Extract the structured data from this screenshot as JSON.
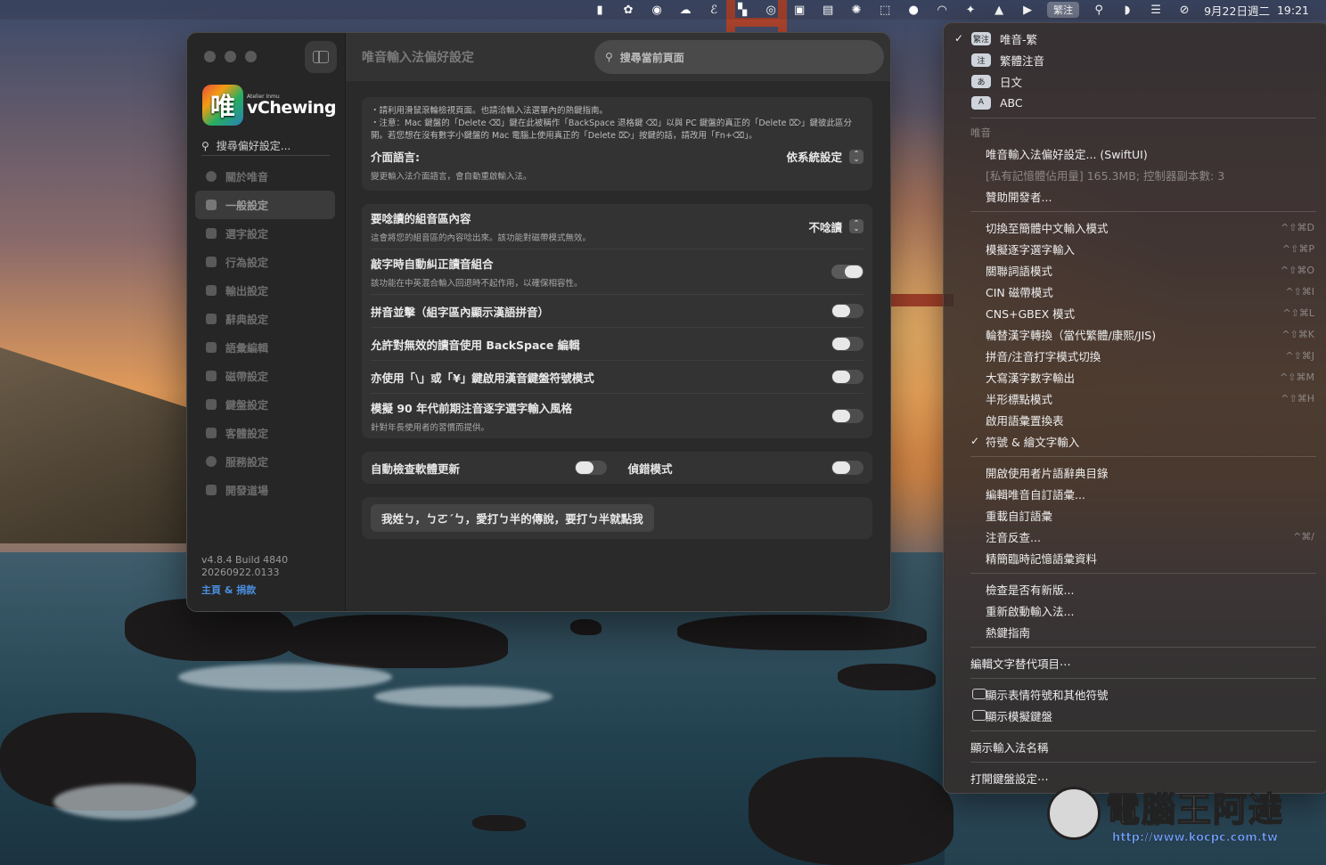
{
  "menubar": {
    "ime_icon": "繁注",
    "date": "9月22日週二",
    "time": "19:21",
    "icons": [
      "battery-icon",
      "openai-icon",
      "finder-icon",
      "cloud-icon",
      "e-app-icon",
      "layout-icon",
      "airdrop-icon",
      "c-app-icon",
      "notion-icon",
      "burst-icon",
      "screenshot-icon",
      "line-app-icon",
      "rss-icon",
      "sparkle-icon",
      "upload-icon",
      "play-icon",
      "search-icon",
      "wifi-icon",
      "control-center-icon",
      "vpn-icon"
    ]
  },
  "window": {
    "title": "唯音輸入法偏好設定",
    "search_placeholder": "搜尋當前頁面",
    "logo_sub": "Atelier Inmu",
    "logo_name": "vChewing",
    "logo_glyph": "唯",
    "side_search_placeholder": "搜尋偏好設定...",
    "nav": [
      {
        "label": "關於唯音",
        "icon": "info-icon"
      },
      {
        "label": "一般設定",
        "icon": "tools-icon"
      },
      {
        "label": "選字設定",
        "icon": "candidate-icon"
      },
      {
        "label": "行為設定",
        "icon": "behavior-icon"
      },
      {
        "label": "輸出設定",
        "icon": "output-icon"
      },
      {
        "label": "辭典設定",
        "icon": "dictionary-icon"
      },
      {
        "label": "語彙編輯",
        "icon": "phrase-edit-icon"
      },
      {
        "label": "磁帶設定",
        "icon": "cassette-icon"
      },
      {
        "label": "鍵盤設定",
        "icon": "keyboard-icon"
      },
      {
        "label": "客體設定",
        "icon": "client-icon"
      },
      {
        "label": "服務設定",
        "icon": "service-icon"
      },
      {
        "label": "開發道場",
        "icon": "dev-icon"
      }
    ],
    "active_nav": 1,
    "version": "v4.8.4 Build 4840",
    "build_date": "20260922.0133",
    "homepage_link": "主頁 & 捐款"
  },
  "general": {
    "notes": [
      "・請利用滑鼠滾輪檢視頁面。也請洽輸入法選單內的熱鍵指南。",
      "・注意：Mac 鍵盤的「Delete ⌫」鍵在此被稱作「BackSpace 退格鍵 ⌫」以與 PC 鍵盤的真正的「Delete ⌦」鍵彼此區分開。若您想在沒有數字小鍵盤的 Mac 電腦上使用真正的「Delete ⌦」按鍵的話，請改用「Fn+⌫」。"
    ],
    "ui_lang_label": "介面語言:",
    "ui_lang_value": "依系統設定",
    "ui_lang_desc": "變更輸入法介面語言，會自動重啟輸入法。",
    "read_label": "要唸讀的組音區內容",
    "read_value": "不唸讀",
    "read_desc": "這會將您的組音區的內容唸出來。該功能對磁帶模式無效。",
    "settings": [
      {
        "label": "敲字時自動糾正讀音組合",
        "desc": "該功能在中英混合輸入回退時不起作用，以確保相容性。",
        "on": true
      },
      {
        "label": "拼音並擊（組字區內顯示漢語拼音）",
        "desc": "",
        "on": false
      },
      {
        "label": "允許對無效的讀音使用 BackSpace 編輯",
        "desc": "",
        "on": false
      },
      {
        "label": "亦使用「\\」或「¥」鍵啟用漢音鍵盤符號模式",
        "desc": "",
        "on": false
      },
      {
        "label": "模擬 90 年代前期注音逐字選字輸入風格",
        "desc": "針對年長使用者的習慣而提供。",
        "on": false
      }
    ],
    "auto_update_label": "自動檢查軟體更新",
    "auto_update_on": false,
    "debug_label": "偵錯模式",
    "debug_on": false,
    "motto_button": "我姓ㄅ，ㄅㄛˊㄅ，愛打ㄅ半的傳說，要打ㄅ半就點我"
  },
  "menu": {
    "input_sources": [
      {
        "badge": "繁注",
        "label": "唯音-繁",
        "checked": true
      },
      {
        "badge": "注",
        "label": "繁體注音",
        "checked": false
      },
      {
        "badge": "あ",
        "label": "日文",
        "checked": false
      },
      {
        "badge": "A",
        "label": "ABC",
        "checked": false
      }
    ],
    "section_header": "唯音",
    "app_items": [
      {
        "label": "唯音輸入法偏好設定... (SwiftUI)",
        "dim": false
      },
      {
        "label": "[私有記憶體佔用量] 165.3MB; 控制器副本數: 3",
        "dim": true
      },
      {
        "label": "贊助開發者...",
        "dim": false
      }
    ],
    "modes": [
      {
        "label": "切換至簡體中文輸入模式",
        "shortcut": "^⇧⌘D",
        "checked": false
      },
      {
        "label": "模擬逐字選字輸入",
        "shortcut": "^⇧⌘P",
        "checked": false
      },
      {
        "label": "關聯詞語模式",
        "shortcut": "^⇧⌘O",
        "checked": false
      },
      {
        "label": "CIN 磁帶模式",
        "shortcut": "^⇧⌘I",
        "checked": false
      },
      {
        "label": "CNS+GBEX 模式",
        "shortcut": "^⇧⌘L",
        "checked": false
      },
      {
        "label": "輪替漢字轉換（當代繁體/康熙/JIS)",
        "shortcut": "^⇧⌘K",
        "checked": false
      },
      {
        "label": "拼音/注音打字模式切換",
        "shortcut": "^⇧⌘J",
        "checked": false
      },
      {
        "label": "大寫漢字數字輸出",
        "shortcut": "^⇧⌘M",
        "checked": false
      },
      {
        "label": "半形標點模式",
        "shortcut": "^⇧⌘H",
        "checked": false
      },
      {
        "label": "啟用語彙置換表",
        "shortcut": "",
        "checked": false
      },
      {
        "label": "符號 & 繪文字輸入",
        "shortcut": "",
        "checked": true
      }
    ],
    "dict_items": [
      {
        "label": "開啟使用者片語辭典目錄",
        "shortcut": ""
      },
      {
        "label": "編輯唯音自訂語彙...",
        "shortcut": ""
      },
      {
        "label": "重載自訂語彙",
        "shortcut": ""
      },
      {
        "label": "注音反查...",
        "shortcut": "^⌘/"
      },
      {
        "label": "精簡臨時記憶語彙資料",
        "shortcut": ""
      }
    ],
    "maint_items": [
      "檢查是否有新版...",
      "重新啟動輸入法...",
      "熱鍵指南"
    ],
    "edit_text": "編輯文字替代項目⋯",
    "system_items": [
      {
        "label": "顯示表情符號和其他符號",
        "icon": "emoji-viewer-icon"
      },
      {
        "label": "顯示模擬鍵盤",
        "icon": "keyboard-viewer-icon"
      }
    ],
    "show_name": "顯示輸入法名稱",
    "open_keyboard": "打開鍵盤設定⋯"
  },
  "watermark": {
    "name": "電腦王阿達",
    "url": "http://www.kocpc.com.tw"
  }
}
